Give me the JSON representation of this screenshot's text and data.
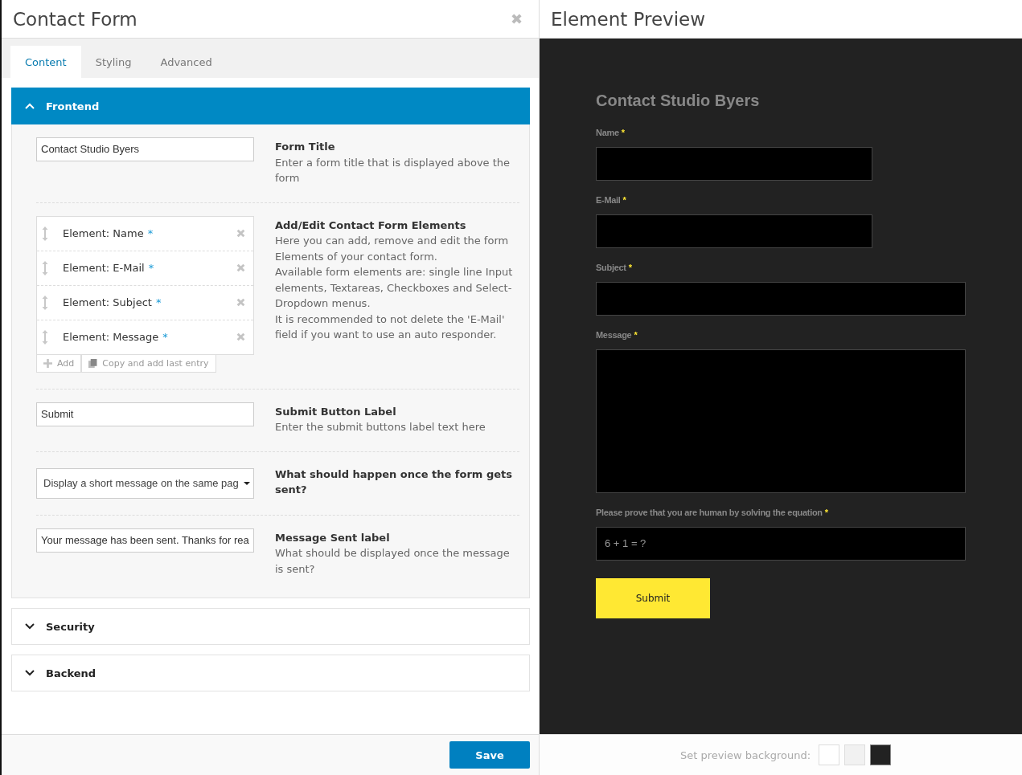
{
  "editor": {
    "title": "Contact Form",
    "close": "✖",
    "tabs": [
      {
        "label": "Content",
        "selected": true
      },
      {
        "label": "Styling",
        "selected": false
      },
      {
        "label": "Advanced",
        "selected": false
      }
    ],
    "sections": [
      {
        "title": "Frontend",
        "expanded": true,
        "settings": [
          {
            "kind": "input",
            "value": "Contact Studio Byers",
            "label": "Form Title",
            "description": [
              "Enter a form title that is displayed above the form"
            ]
          },
          {
            "kind": "elements",
            "elements": [
              {
                "label": "Element: Name",
                "mark": "*"
              },
              {
                "label": "Element: E-Mail",
                "mark": "*"
              },
              {
                "label": "Element: Subject",
                "mark": "*"
              },
              {
                "label": "Element: Message",
                "mark": "*"
              }
            ],
            "add": "Add",
            "copy": "Copy and add last entry",
            "label": "Add/Edit Contact Form Elements",
            "description": [
              "Here you can add, remove and edit the form Elements of your contact form.",
              "Available form elements are: single line Input elements, Textareas, Checkboxes and Select-Dropdown menus.",
              "It is recommended to not delete the 'E-Mail' field if you want to use an auto responder."
            ]
          },
          {
            "kind": "input",
            "value": "Submit",
            "label": "Submit Button Label",
            "description": [
              "Enter the submit buttons label text here"
            ]
          },
          {
            "kind": "select",
            "value": "Display a short message on the same pag",
            "label": "What should happen once the form gets sent?"
          },
          {
            "kind": "input",
            "value": "Your message has been sent. Thanks for rea",
            "label": "Message Sent label",
            "description": [
              "What should be displayed once the message is sent?"
            ]
          }
        ]
      },
      {
        "title": "Security",
        "expanded": false
      },
      {
        "title": "Backend",
        "expanded": false
      }
    ],
    "save": "Save"
  },
  "preview": {
    "title": "Element Preview",
    "form_title": "Contact Studio Byers",
    "fields": [
      {
        "kind": "short",
        "label": "Name",
        "mark": "*"
      },
      {
        "kind": "short",
        "label": "E-Mail",
        "mark": "*"
      },
      {
        "kind": "text",
        "label": "Subject",
        "mark": "*"
      },
      {
        "kind": "textarea",
        "label": "Message",
        "mark": "*"
      },
      {
        "kind": "text",
        "label": "Please prove that you are human by solving the equation",
        "mark": "*",
        "placeholder": "6 + 1 = ?"
      }
    ],
    "submit": "Submit",
    "background_label": "Set preview background:",
    "swatches": [
      {
        "color": "#ffffff",
        "selected": false
      },
      {
        "color": "#f1f1f1",
        "selected": false
      },
      {
        "color": "#222222",
        "selected": true
      }
    ]
  }
}
